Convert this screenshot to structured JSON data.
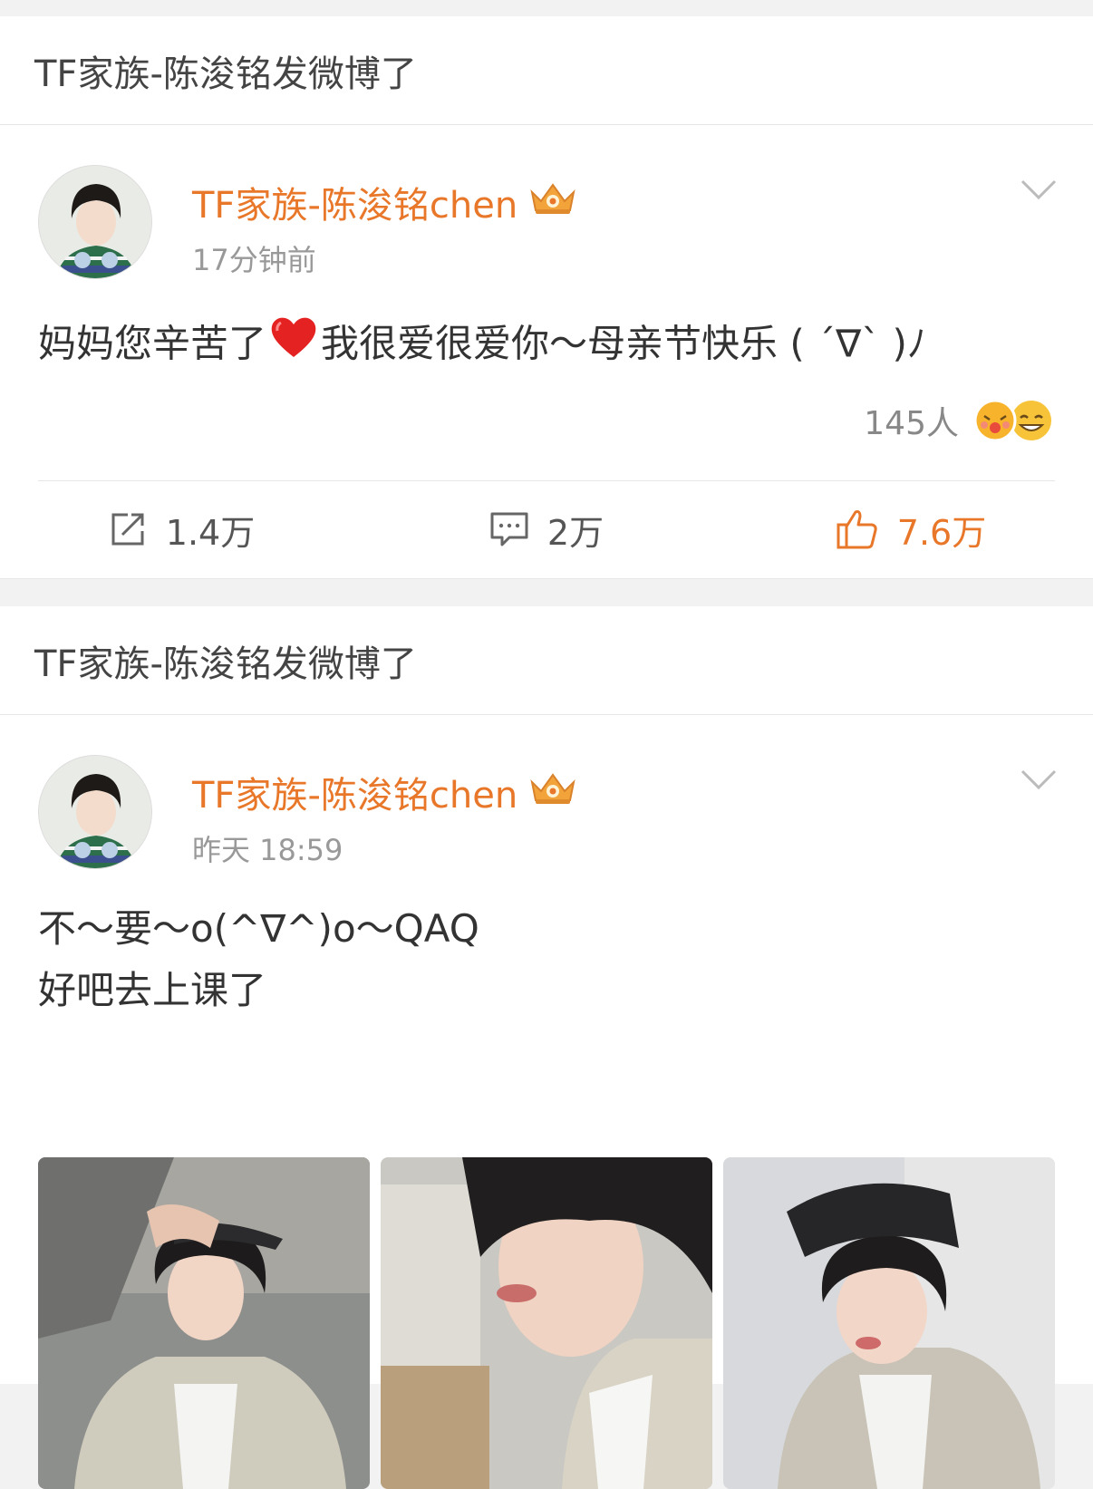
{
  "feed": [
    {
      "header": "TF家族-陈浚铭发微博了",
      "user_name": "TF家族-陈浚铭chen",
      "time": "17分钟前",
      "text_lines": [
        "妈妈您辛苦了",
        "我很爱很爱你～母亲节快乐 ( ´∇` )ﾉ"
      ],
      "reaction_count": "145人",
      "actions": {
        "repost": "1.4万",
        "comment": "2万",
        "like": "7.6万"
      },
      "icons": [
        "crown-icon",
        "chevron-down-icon",
        "heart-icon",
        "emoji-faces-icon",
        "repost-icon",
        "comment-icon",
        "thumbs-up-icon"
      ]
    },
    {
      "header": "TF家族-陈浚铭发微博了",
      "user_name": "TF家族-陈浚铭chen",
      "time": "昨天 18:59",
      "text_lines": [
        "不～要～o(^∇^)o～QAQ",
        "好吧去上课了"
      ],
      "photos": 3
    }
  ],
  "colors": {
    "accent": "#e8772a",
    "muted": "#999999",
    "background": "#f2f2f2"
  }
}
